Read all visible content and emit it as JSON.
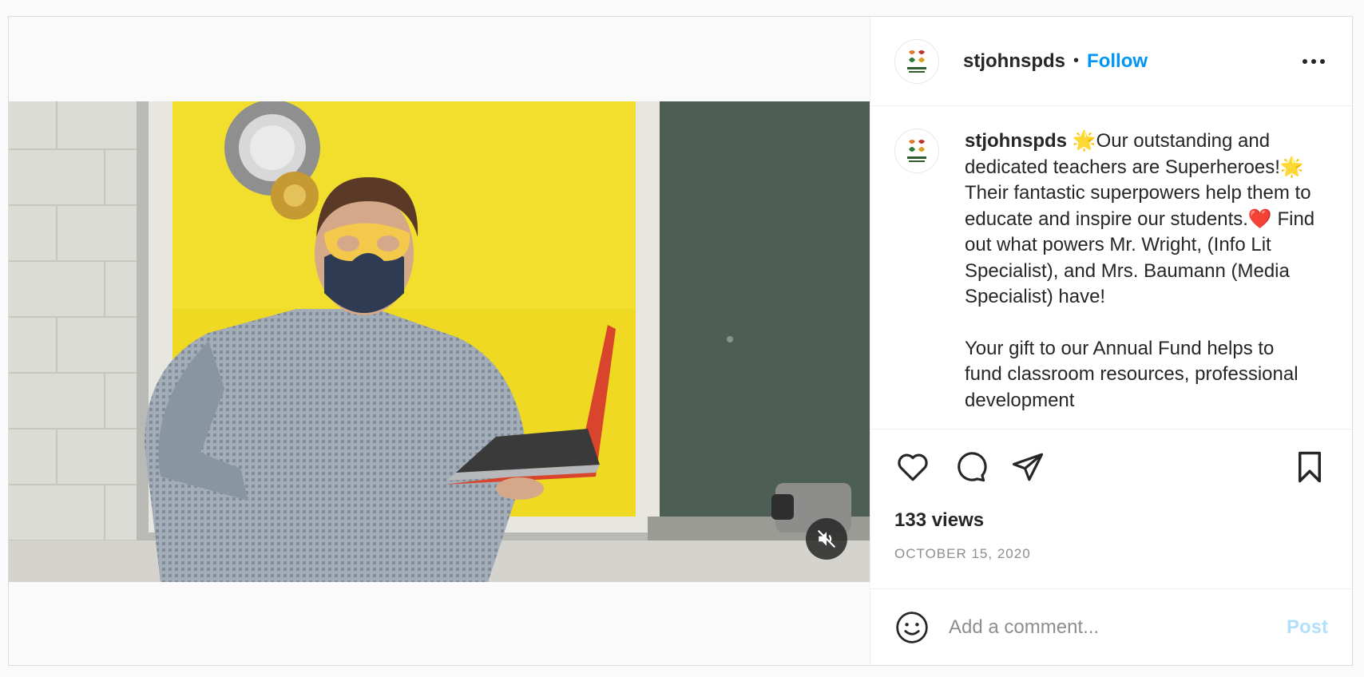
{
  "header": {
    "username": "stjohnspds",
    "separator": "•",
    "follow_label": "Follow",
    "avatar_icon": "school-crest-logo",
    "more_icon": "more-options-icon"
  },
  "caption": {
    "username": "stjohnspds",
    "paragraph1": "🌟Our outstanding and dedicated teachers are Superheroes!🌟 Their fantastic superpowers help them to educate and inspire our students.❤️ Find out what powers Mr. Wright, (Info Lit Specialist), and Mrs. Baumann (Media Specialist) have!",
    "paragraph2": "Your gift to our Annual Fund helps to fund classroom resources, professional development"
  },
  "actions": {
    "like_icon": "heart-icon",
    "comment_icon": "comment-icon",
    "share_icon": "share-icon",
    "save_icon": "bookmark-icon",
    "views": "133 views",
    "date": "OCTOBER 15, 2020"
  },
  "video": {
    "mute_icon": "muted-speaker-icon"
  },
  "comment": {
    "placeholder": "Add a comment...",
    "post_label": "Post",
    "emoji_icon": "emoji-icon"
  },
  "colors": {
    "link": "#0095f6",
    "post_disabled": "#b2dffc",
    "secondary_text": "#8e8e8e"
  }
}
